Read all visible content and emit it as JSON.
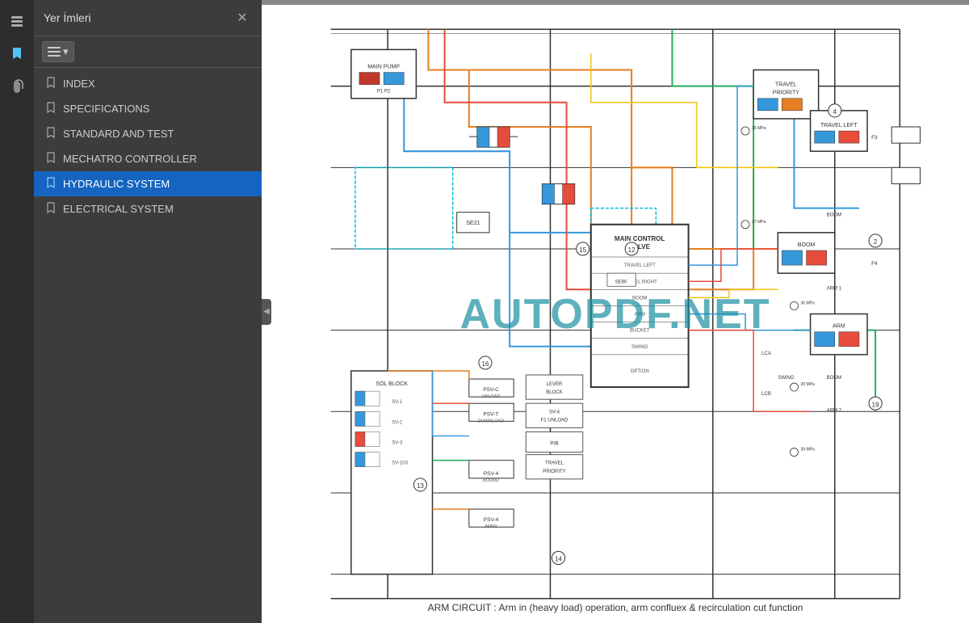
{
  "toolbar": {
    "items": [
      {
        "name": "layers-icon",
        "symbol": "⊞",
        "active": false
      },
      {
        "name": "bookmarks-icon",
        "symbol": "🔖",
        "active": true
      },
      {
        "name": "attachments-icon",
        "symbol": "📎",
        "active": false
      }
    ]
  },
  "sidebar": {
    "title": "Yer İmleri",
    "close_label": "✕",
    "toolbar_btn_label": "☰",
    "toolbar_dropdown": "▾",
    "bookmarks": [
      {
        "id": "index",
        "label": "INDEX",
        "active": false
      },
      {
        "id": "specifications",
        "label": "SPECIFICATIONS",
        "active": false
      },
      {
        "id": "standard-and-test",
        "label": "STANDARD AND TEST",
        "active": false
      },
      {
        "id": "mechatro-controller",
        "label": "MECHATRO CONTROLLER",
        "active": false
      },
      {
        "id": "hydraulic-system",
        "label": "HYDRAULIC SYSTEM",
        "active": true
      },
      {
        "id": "electrical-system",
        "label": "ELECTRICAL SYSTEM",
        "active": false
      }
    ],
    "collapse_icon": "◀"
  },
  "diagram": {
    "watermark": "AUTOPDF.NET",
    "caption": "ARM CIRCUIT : Arm in (heavy load) operation, arm confluex & recirculation cut function"
  }
}
